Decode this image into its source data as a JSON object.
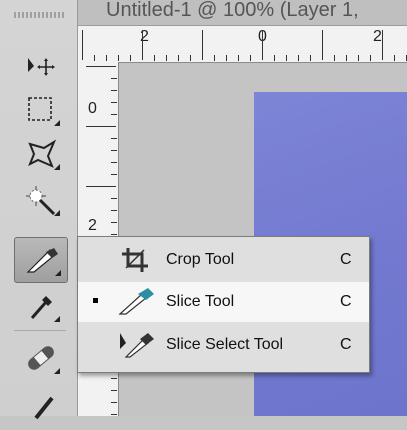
{
  "document": {
    "title": "Untitled-1 @ 100% (Layer 1,"
  },
  "ruler": {
    "top_labels": [
      "2",
      "0",
      "2"
    ],
    "left_labels": [
      "0",
      "2"
    ]
  },
  "toolbar": {
    "tools": [
      {
        "name": "move-tool",
        "icon": "move-icon"
      },
      {
        "name": "marquee-tool",
        "icon": "marquee-icon"
      },
      {
        "name": "lasso-tool",
        "icon": "lasso-icon"
      },
      {
        "name": "magic-wand-tool",
        "icon": "magic-wand-icon"
      },
      {
        "name": "slice-tool",
        "icon": "slice-icon",
        "active": true
      },
      {
        "name": "eyedropper-tool",
        "icon": "eyedropper-icon"
      },
      {
        "name": "healing-brush-tool",
        "icon": "bandage-icon"
      }
    ]
  },
  "flyout": {
    "items": [
      {
        "label": "Crop Tool",
        "shortcut": "C",
        "icon": "crop-icon",
        "selected": false
      },
      {
        "label": "Slice Tool",
        "shortcut": "C",
        "icon": "slice-icon",
        "selected": true
      },
      {
        "label": "Slice Select Tool",
        "shortcut": "C",
        "icon": "slice-select-icon",
        "selected": false
      }
    ]
  },
  "colors": {
    "canvas": "#7279cf",
    "slice_accent": "#2a8fa3"
  }
}
